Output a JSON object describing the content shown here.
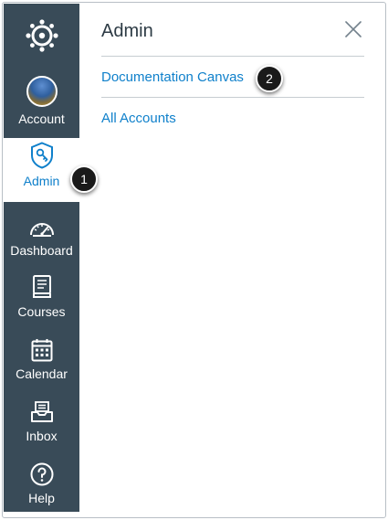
{
  "global_nav": {
    "items": [
      {
        "label": "Account",
        "icon": "user-avatar"
      },
      {
        "label": "Admin",
        "icon": "shield-key-icon",
        "active": true
      },
      {
        "label": "Dashboard",
        "icon": "speedometer-icon"
      },
      {
        "label": "Courses",
        "icon": "book-icon"
      },
      {
        "label": "Calendar",
        "icon": "calendar-icon"
      },
      {
        "label": "Inbox",
        "icon": "inbox-icon"
      },
      {
        "label": "Help",
        "icon": "question-circle-icon"
      }
    ]
  },
  "tray": {
    "title": "Admin",
    "links": [
      "Documentation Canvas",
      "All Accounts"
    ]
  },
  "callouts": [
    "1",
    "2"
  ],
  "colors": {
    "nav_bg": "#394b58",
    "link": "#0f80cb",
    "active_text": "#0f80cb",
    "title_text": "#2d3b45"
  }
}
